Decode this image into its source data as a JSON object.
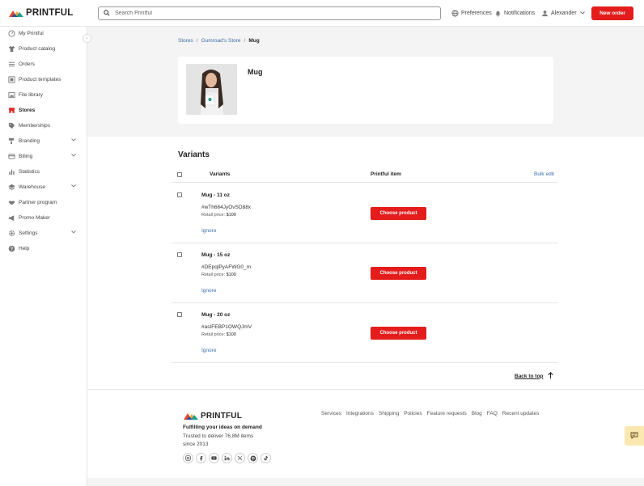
{
  "header": {
    "logo_text": "PRINTFUL",
    "search_placeholder": "Search Printful",
    "preferences_label": "Preferences",
    "notifications_label": "Notifications",
    "user_name": "Alexander",
    "new_order_label": "New order"
  },
  "sidebar": {
    "items": [
      {
        "label": "My Printful"
      },
      {
        "label": "Product catalog"
      },
      {
        "label": "Orders"
      },
      {
        "label": "Product templates"
      },
      {
        "label": "File library"
      },
      {
        "label": "Stores"
      },
      {
        "label": "Memberships"
      },
      {
        "label": "Branding"
      },
      {
        "label": "Billing"
      },
      {
        "label": "Statistics"
      },
      {
        "label": "Warehouse"
      },
      {
        "label": "Partner program"
      },
      {
        "label": "Promo Maker"
      },
      {
        "label": "Settings"
      },
      {
        "label": "Help"
      }
    ],
    "active_index": 5
  },
  "breadcrumb": {
    "items": [
      "Stores",
      "Gumroad's Store"
    ],
    "current": "Mug",
    "separator": "/"
  },
  "product": {
    "title": "Mug"
  },
  "variants": {
    "title": "Variants",
    "col_variants": "Variants",
    "col_printful_item": "Printful item",
    "bulk_edit": "Bulk edit",
    "retail_label": "Retail price:",
    "ignore_label": "Ignore",
    "choose_label": "Choose product",
    "rows": [
      {
        "name": "Mug - 11 oz",
        "id": "#wTh664JyOvSD88x",
        "price": "$100"
      },
      {
        "name": "Mug - 15 oz",
        "id": "#DEpqlPyAFWG0_m",
        "price": "$100"
      },
      {
        "name": "Mug - 20 oz",
        "id": "#asIFEBP1OWQJmVi",
        "price": "$100"
      }
    ]
  },
  "back_to_top": "Back to top",
  "footer": {
    "logo_text": "PRINTFUL",
    "tagline": "Fulfilling your ideas on demand",
    "trusted": "Trusted to deliver 76.8M items since 2013",
    "links": [
      "Services",
      "Integrations",
      "Shipping",
      "Policies",
      "Feature requests",
      "Blog",
      "FAQ",
      "Recent updates"
    ],
    "socials": [
      "instagram-icon",
      "facebook-icon",
      "youtube-icon",
      "linkedin-icon",
      "x-icon",
      "pinterest-icon",
      "tiktok-icon"
    ]
  },
  "colors": {
    "accent_red": "#e41c1c",
    "link_blue": "#3b6ea8",
    "gray_bg": "#f4f4f4",
    "feedback_yellow": "#fbe7b0"
  }
}
